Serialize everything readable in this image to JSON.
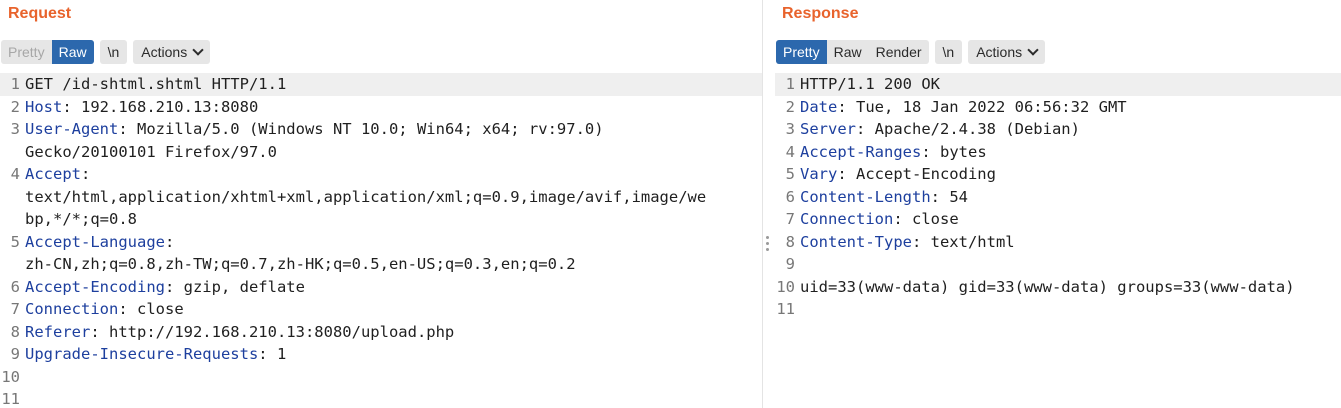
{
  "request": {
    "title": "Request",
    "tabs": [
      "Pretty",
      "Raw"
    ],
    "active_tab": "Raw",
    "newline_btn": "\\n",
    "actions_btn": "Actions",
    "lines": [
      {
        "n": "1",
        "text": "GET /id-shtml.shtml HTTP/1.1"
      },
      {
        "n": "2",
        "key": "Host",
        "value": ": 192.168.210.13:8080"
      },
      {
        "n": "3",
        "key": "User-Agent",
        "value": ": Mozilla/5.0 (Windows NT 10.0; Win64; x64; rv:97.0)"
      },
      {
        "n": "",
        "text": "Gecko/20100101 Firefox/97.0"
      },
      {
        "n": "4",
        "key": "Accept",
        "value": ":"
      },
      {
        "n": "",
        "text": "text/html,application/xhtml+xml,application/xml;q=0.9,image/avif,image/we"
      },
      {
        "n": "",
        "text": "bp,*/*;q=0.8"
      },
      {
        "n": "5",
        "key": "Accept-Language",
        "value": ":"
      },
      {
        "n": "",
        "text": "zh-CN,zh;q=0.8,zh-TW;q=0.7,zh-HK;q=0.5,en-US;q=0.3,en;q=0.2"
      },
      {
        "n": "6",
        "key": "Accept-Encoding",
        "value": ": gzip, deflate"
      },
      {
        "n": "7",
        "key": "Connection",
        "value": ": close"
      },
      {
        "n": "8",
        "key": "Referer",
        "value": ": http://192.168.210.13:8080/upload.php"
      },
      {
        "n": "9",
        "key": "Upgrade-Insecure-Requests",
        "value": ": 1"
      },
      {
        "n": "10",
        "text": ""
      },
      {
        "n": "11",
        "text": ""
      }
    ]
  },
  "response": {
    "title": "Response",
    "tabs": [
      "Pretty",
      "Raw",
      "Render"
    ],
    "active_tab": "Pretty",
    "newline_btn": "\\n",
    "actions_btn": "Actions",
    "lines": [
      {
        "n": "1",
        "text": "HTTP/1.1 200 OK"
      },
      {
        "n": "2",
        "key": "Date",
        "value": ": Tue, 18 Jan 2022 06:56:32 GMT"
      },
      {
        "n": "3",
        "key": "Server",
        "value": ": Apache/2.4.38 (Debian)"
      },
      {
        "n": "4",
        "key": "Accept-Ranges",
        "value": ": bytes"
      },
      {
        "n": "5",
        "key": "Vary",
        "value": ": Accept-Encoding"
      },
      {
        "n": "6",
        "key": "Content-Length",
        "value": ": 54"
      },
      {
        "n": "7",
        "key": "Connection",
        "value": ": close"
      },
      {
        "n": "8",
        "key": "Content-Type",
        "value": ": text/html"
      },
      {
        "n": "9",
        "text": ""
      },
      {
        "n": "10",
        "text": "uid=33(www-data) gid=33(www-data) groups=33(www-data)"
      },
      {
        "n": "11",
        "text": ""
      }
    ]
  },
  "colors": {
    "title": "#e8632c",
    "active_tab": "#2c68ad",
    "header_key": "#1d3f9e"
  }
}
